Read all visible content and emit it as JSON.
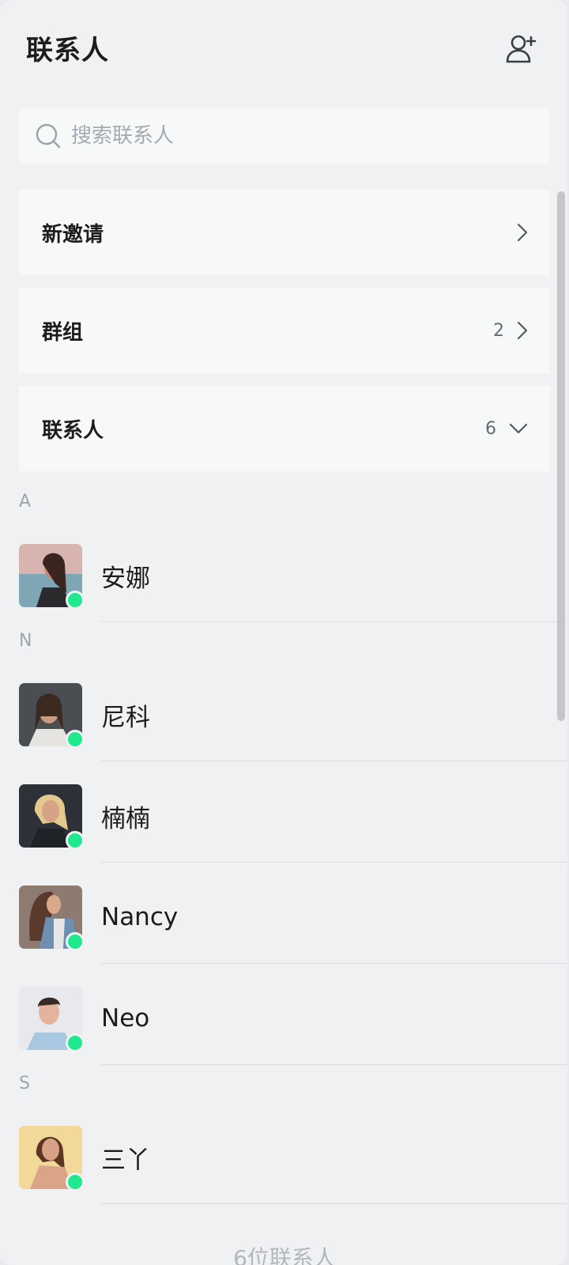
{
  "header": {
    "title": "联系人",
    "add_icon": "add-user-icon"
  },
  "search": {
    "placeholder": "搜索联系人",
    "icon": "search-icon"
  },
  "menu": {
    "invites": {
      "label": "新邀请"
    },
    "groups": {
      "label": "群组",
      "count": "2"
    },
    "contacts": {
      "label": "联系人",
      "count": "6"
    }
  },
  "sections": [
    {
      "letter": "A",
      "contacts": [
        {
          "name": "安娜"
        }
      ]
    },
    {
      "letter": "N",
      "contacts": [
        {
          "name": "尼科"
        },
        {
          "name": "楠楠"
        },
        {
          "name": "Nancy"
        },
        {
          "name": "Neo"
        }
      ]
    },
    {
      "letter": "S",
      "contacts": [
        {
          "name": "三丫"
        }
      ]
    }
  ],
  "footer": {
    "count_text": "6位联系人"
  },
  "colors": {
    "online": "#1fe88e",
    "background": "#f0f1f3",
    "card": "#f7f8f8"
  }
}
